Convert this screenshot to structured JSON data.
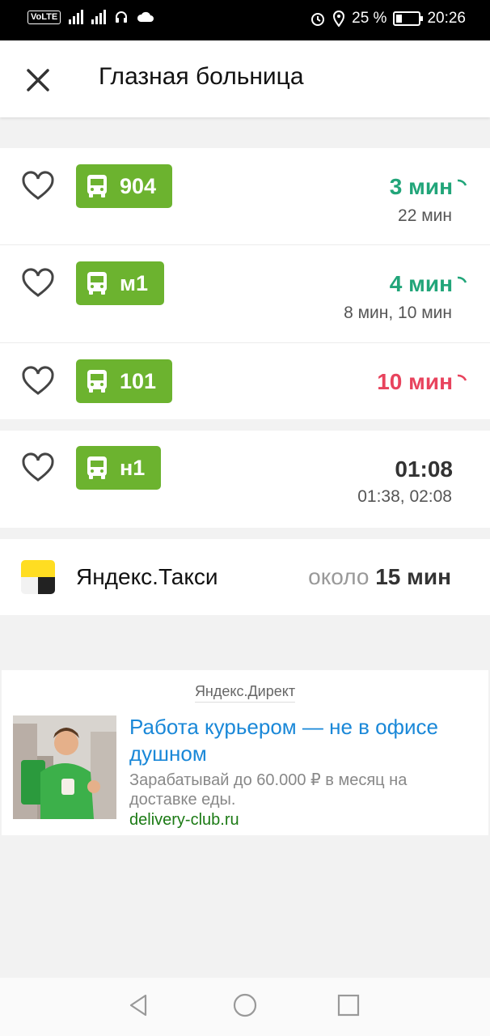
{
  "status_bar": {
    "network": "VoLTE",
    "battery_text": "25 %",
    "time": "20:26",
    "icons": [
      "signal-icon",
      "4g-signal-icon",
      "headset-icon",
      "cloud-icon",
      "alarm-icon",
      "location-icon",
      "battery-icon"
    ]
  },
  "header": {
    "title": "Глазная больница",
    "close_icon": "close-icon"
  },
  "routes": [
    {
      "number": "904",
      "eta": "3 мин",
      "eta_color": "#21a579",
      "next": "22 мин"
    },
    {
      "number": "м1",
      "eta": "4 мин",
      "eta_color": "#21a579",
      "next": "8 мин, 10 мин"
    },
    {
      "number": "101",
      "eta": "10 мин",
      "eta_color": "#e8435d",
      "next": ""
    },
    {
      "number": "н1",
      "eta": "01:08",
      "eta_color": "#333333",
      "next": "01:38, 02:08"
    }
  ],
  "taxi": {
    "name": "Яндекс.Такси",
    "eta_prefix": "около",
    "eta_value": "15 мин"
  },
  "ad": {
    "label": "Яндекс.Директ",
    "title": "Работа курьером — не в офисе душном",
    "text": "Зарабатывай до 60.000 ₽ в месяц на доставке еды.",
    "domain": "delivery-club.ru"
  },
  "colors": {
    "badge_green": "#6cb32f",
    "eta_green": "#21a579",
    "eta_red": "#e8435d",
    "link_blue": "#1a88d8"
  },
  "navbar": {
    "icons": [
      "back-icon",
      "home-icon",
      "recents-icon"
    ]
  }
}
